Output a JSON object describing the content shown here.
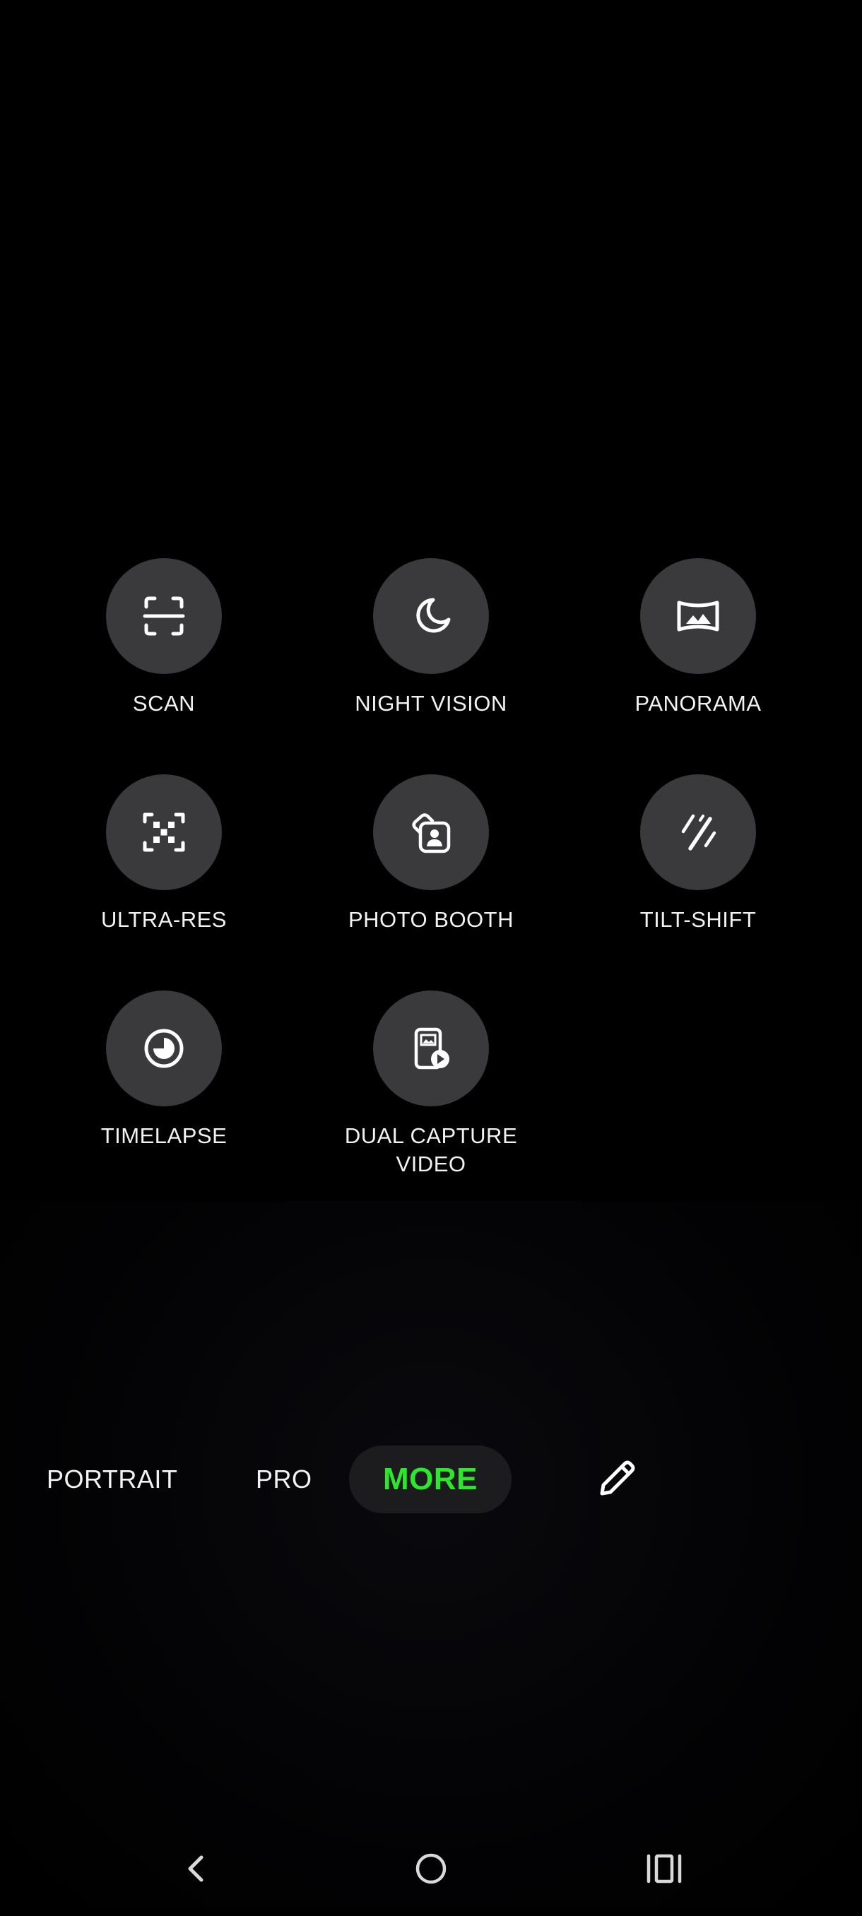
{
  "modes": [
    {
      "id": "scan",
      "label": "SCAN",
      "icon": "scan-icon"
    },
    {
      "id": "night-vision",
      "label": "NIGHT VISION",
      "icon": "moon-icon"
    },
    {
      "id": "panorama",
      "label": "PANORAMA",
      "icon": "panorama-icon"
    },
    {
      "id": "ultra-res",
      "label": "ULTRA-RES",
      "icon": "ultra-res-icon"
    },
    {
      "id": "photo-booth",
      "label": "PHOTO BOOTH",
      "icon": "photo-booth-icon"
    },
    {
      "id": "tilt-shift",
      "label": "TILT-SHIFT",
      "icon": "tilt-shift-icon"
    },
    {
      "id": "timelapse",
      "label": "TIMELAPSE",
      "icon": "timelapse-icon"
    },
    {
      "id": "dual-capture-video",
      "label": "DUAL CAPTURE\nVIDEO",
      "icon": "dual-capture-video-icon"
    }
  ],
  "mode_bar": {
    "portrait": "PORTRAIT",
    "pro": "PRO",
    "more": "MORE",
    "edit_icon": "pencil-icon"
  },
  "nav": {
    "back_icon": "back-chevron-icon",
    "home_icon": "home-circle-icon",
    "recents_icon": "recents-icon"
  },
  "colors": {
    "background": "#000000",
    "circle": "#3a3a3c",
    "active_pill": "#1c1c1e",
    "accent_green": "#2ee62e",
    "text": "#f2f2f2"
  }
}
